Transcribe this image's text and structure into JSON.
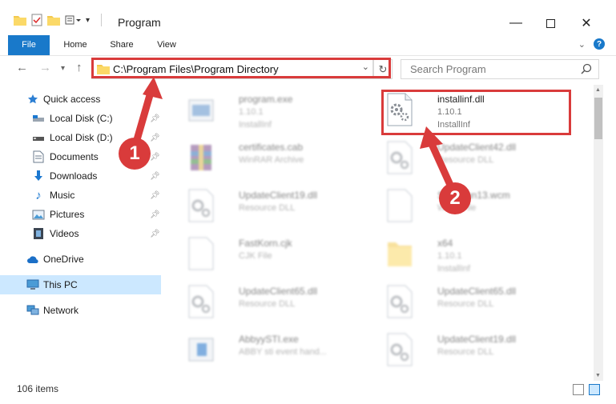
{
  "window": {
    "title": "Program"
  },
  "ribbon": {
    "tabs": [
      "File",
      "Home",
      "Share",
      "View"
    ],
    "help_label": "?"
  },
  "address": {
    "path": "C:\\Program Files\\Program Directory"
  },
  "search": {
    "placeholder": "Search Program"
  },
  "sidebar": {
    "items": [
      {
        "label": "Quick access",
        "icon": "star-icon"
      },
      {
        "label": "Local Disk (C:)",
        "icon": "drive-icon",
        "pinned": true
      },
      {
        "label": "Local Disk (D:)",
        "icon": "drive-icon",
        "pinned": true
      },
      {
        "label": "Documents",
        "icon": "documents-icon",
        "pinned": true
      },
      {
        "label": "Downloads",
        "icon": "downloads-icon",
        "pinned": true
      },
      {
        "label": "Music",
        "icon": "music-icon",
        "pinned": true
      },
      {
        "label": "Pictures",
        "icon": "pictures-icon",
        "pinned": true
      },
      {
        "label": "Videos",
        "icon": "videos-icon",
        "pinned": true
      },
      {
        "label": "OneDrive",
        "icon": "onedrive-icon"
      },
      {
        "label": "This PC",
        "icon": "this-pc-icon",
        "selected": true
      },
      {
        "label": "Network",
        "icon": "network-icon"
      }
    ]
  },
  "files": [
    {
      "name": "program.exe",
      "line2": "1.10.1",
      "line3": "InstallInf",
      "kind": "exe",
      "focus": false
    },
    {
      "name": "installinf.dll",
      "line2": "1.10.1",
      "line3": "InstallInf",
      "kind": "dll",
      "focus": true
    },
    {
      "name": "certificates.cab",
      "line2": "WinRAR Archive",
      "line3": "",
      "kind": "cab",
      "focus": false
    },
    {
      "name": "UpdateClient42.dll",
      "line2": "Resource DLL",
      "line3": "",
      "kind": "dll",
      "focus": false
    },
    {
      "name": "UpdateClient19.dll",
      "line2": "Resource DLL",
      "line3": "",
      "kind": "dll",
      "focus": false
    },
    {
      "name": "SmdiRun13.wcm",
      "line2": "WCM File",
      "line3": "",
      "kind": "doc",
      "focus": false
    },
    {
      "name": "FastKorn.cjk",
      "line2": "CJK File",
      "line3": "",
      "kind": "doc",
      "focus": false
    },
    {
      "name": "x64",
      "line2": "1.10.1",
      "line3": "InstallInf",
      "kind": "folder",
      "focus": false
    },
    {
      "name": "UpdateClient65.dll",
      "line2": "Resource DLL",
      "line3": "",
      "kind": "dll",
      "focus": false
    },
    {
      "name": "UpdateClient65.dll",
      "line2": "Resource DLL",
      "line3": "",
      "kind": "dll",
      "focus": false
    },
    {
      "name": "AbbyySTI.exe",
      "line2": "ABBY sti event hand...",
      "line3": "",
      "kind": "exe2",
      "focus": false
    },
    {
      "name": "UpdateClient19.dll",
      "line2": "Resource DLL",
      "line3": "",
      "kind": "dll",
      "focus": false
    }
  ],
  "annotations": {
    "badge1": "1",
    "badge2": "2",
    "accent": "#d93b3b"
  },
  "status": {
    "item_count": "106 items"
  },
  "colors": {
    "accent": "#1979ca",
    "selection": "#cce8ff",
    "highlight": "#d93b3b"
  }
}
